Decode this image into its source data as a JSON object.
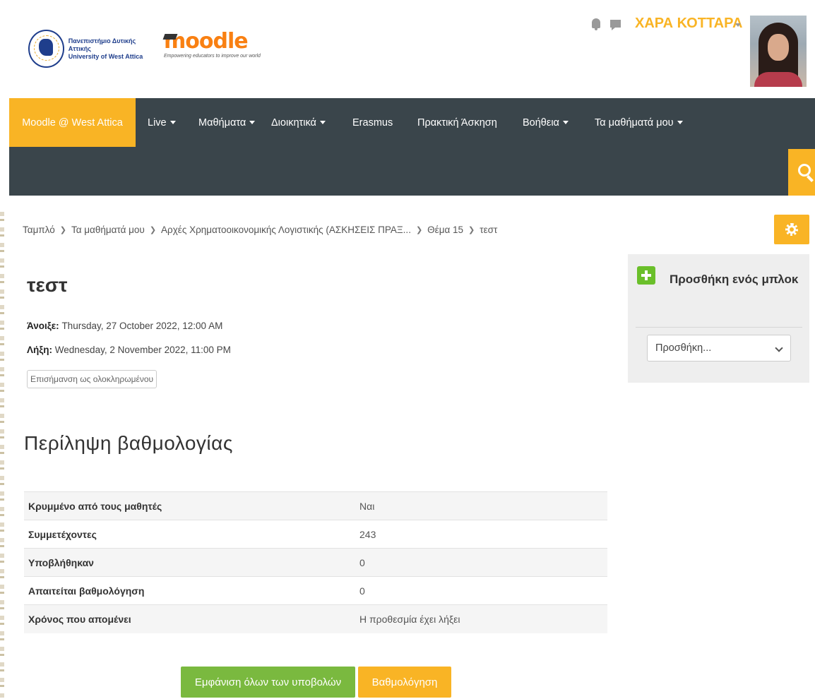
{
  "header": {
    "university_line1": "Πανεπιστήμιο Δυτικής Αττικής",
    "university_line2": "University of West Attica",
    "moodle_word": "moodle",
    "moodle_tagline": "Empowering educators to improve our world",
    "user_name": "ΧΑΡΑ ΚΟΤΤΑΡΑ"
  },
  "nav": {
    "brand": "Moodle @ West Attica",
    "items": [
      {
        "label": "Live",
        "dropdown": true
      },
      {
        "label": "Μαθήματα",
        "dropdown": true
      },
      {
        "label": "Διοικητικά",
        "dropdown": true
      },
      {
        "label": "Erasmus",
        "dropdown": false
      },
      {
        "label": "Πρακτική Άσκηση",
        "dropdown": false
      },
      {
        "label": "Βοήθεια",
        "dropdown": true
      },
      {
        "label": "Τα μαθήματά μου",
        "dropdown": true
      }
    ]
  },
  "breadcrumb": [
    "Ταμπλό",
    "Τα μαθήματά μου",
    "Αρχές Χρηματοοικονομικής Λογιστικής (ΑΣΚΗΣΕΙΣ ΠΡΑΞ...",
    "Θέμα 15",
    "τεστ"
  ],
  "assignment": {
    "title": "τεστ",
    "opened_label": "Άνοιξε:",
    "opened_value": "Thursday, 27 October 2022, 12:00 AM",
    "due_label": "Λήξη:",
    "due_value": "Wednesday, 2 November 2022, 11:00 PM",
    "mark_done": "Επισήμανση ως ολοκληρωμένου"
  },
  "grading": {
    "title": "Περίληψη βαθμολογίας",
    "rows": [
      {
        "label": "Κρυμμένο από τους μαθητές",
        "value": "Ναι"
      },
      {
        "label": "Συμμετέχοντες",
        "value": "243"
      },
      {
        "label": "Υποβλήθηκαν",
        "value": "0"
      },
      {
        "label": "Απαιτείται βαθμολόγηση",
        "value": "0"
      },
      {
        "label": "Χρόνος που απομένει",
        "value": "Η προθεσμία έχει λήξει"
      }
    ],
    "view_all_button": "Εμφάνιση όλων των υποβολών",
    "grade_button": "Βαθμολόγηση"
  },
  "block": {
    "title": "Προσθήκη ενός μπλοκ",
    "select_value": "Προσθήκη..."
  },
  "colors": {
    "accent": "#f9b425",
    "navbar": "#3a454b",
    "green": "#7ab93f"
  }
}
